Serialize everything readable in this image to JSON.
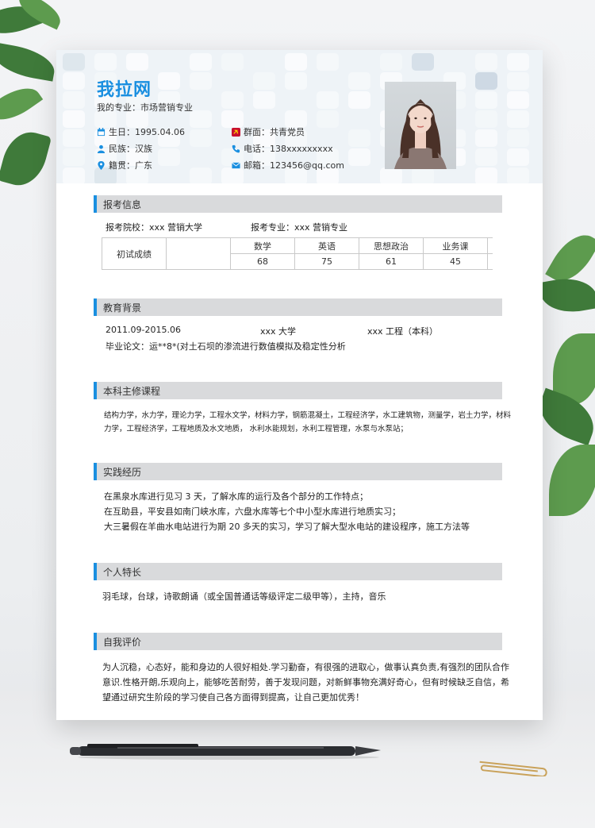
{
  "resume": {
    "name": "我拉网",
    "major": "我的专业：市场营销专业",
    "info": {
      "birth": "生日：1995.04.06",
      "ethnic": "民族：汉族",
      "hometown": "籍贯：广东",
      "politics": "群面：共青党员",
      "phone": "电话：138xxxxxxxxx",
      "email": "邮箱：123456@qq.com"
    }
  },
  "sections": {
    "exam": {
      "title": "报考信息",
      "school": "报考院校：xxx 营销大学",
      "major": "报考专业：xxx 营销专业",
      "scores": {
        "row_label": "初试成绩",
        "subjects": [
          "数学",
          "英语",
          "思想政治",
          "业务课"
        ],
        "values": [
          "68",
          "75",
          "61",
          "45"
        ]
      }
    },
    "education": {
      "title": "教育背景",
      "period": "2011.09-2015.06",
      "school": "xxx 大学",
      "degree": "xxx 工程（本科）",
      "thesis": "毕业论文：运**8*(对土石坝的渗流进行数值模拟及稳定性分析"
    },
    "courses": {
      "title": "本科主修课程",
      "line1": "结构力学，水力学，理论力学，工程水文学，材料力学，钢筋混凝土，工程经济学，水工建筑物，测量学，岩土力学，材料",
      "line2": "力学，工程经济学，工程地质及水文地质，  水利水能规划，水利工程管理，水泵与水泵站；"
    },
    "practice": {
      "title": "实践经历",
      "lines": [
        "在黑泉水库进行见习 3 天，了解水库的运行及各个部分的工作特点；",
        "在互助县，平安县如南门峡水库，六盘水库等七个中小型水库进行地质实习；",
        "大三暑假在羊曲水电站进行为期 20 多天的实习，学习了解大型水电站的建设程序，施工方法等"
      ]
    },
    "skills": {
      "title": "个人特长",
      "text": "羽毛球，台球，诗歌朗诵（或全国普通话等级评定二级甲等），主持，音乐"
    },
    "self": {
      "title": "自我评价",
      "lines": [
        "为人沉稳，心态好，能和身边的人很好相处.学习勤奋，有很强的进取心，做事认真负责,有强烈的团队合作",
        "意识.性格开朗,乐观向上，能够吃苦耐劳，善于发现问题，对新鲜事物充满好奇心，但有时候缺乏自信，希",
        "望通过研究生阶段的学习使自己各方面得到提高，让自己更加优秀！"
      ]
    }
  },
  "colors": {
    "accent": "#1a8fe0",
    "section_bg": "#d9dadc",
    "header_bg": "#eef3f7"
  },
  "icons": [
    "calendar-icon",
    "person-icon",
    "location-icon",
    "party-icon",
    "phone-icon",
    "mail-icon"
  ]
}
